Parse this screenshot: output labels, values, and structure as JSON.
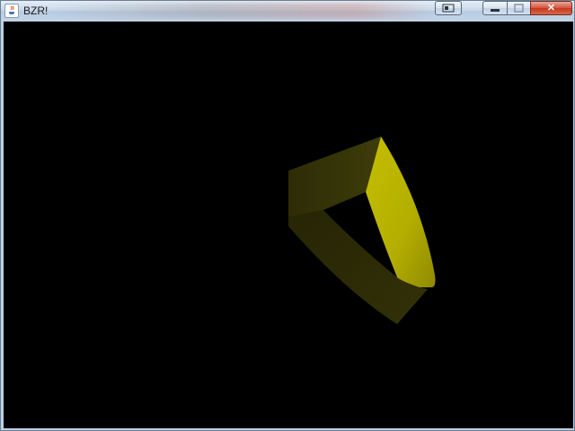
{
  "window": {
    "title": "BZR!",
    "icon": "java-cup-icon",
    "controls": {
      "extra_icon": "window-switch-icon",
      "minimize_icon": "minimize-icon",
      "maximize_icon": "maximize-icon",
      "close_icon": "close-icon",
      "close_glyph": "✕"
    }
  },
  "scene": {
    "background_color": "#000000",
    "object": "yellow-ring-shape",
    "lit_face_color": "#b9b400",
    "shadow_face_color": "#2f2e05"
  }
}
